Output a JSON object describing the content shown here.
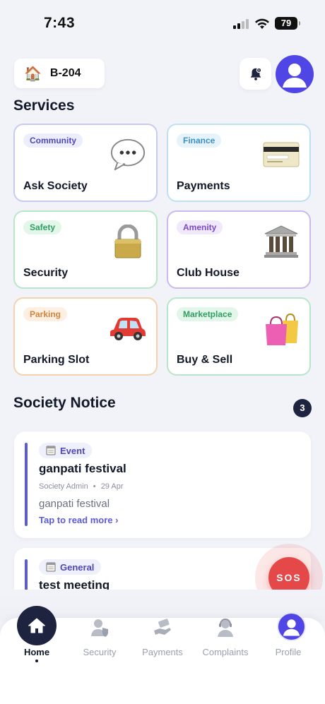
{
  "status_bar": {
    "time": "7:43",
    "battery": "79"
  },
  "header": {
    "unit": "B-204"
  },
  "services": {
    "title": "Services",
    "cards": [
      {
        "tag": "Community",
        "title": "Ask Society",
        "icon": "speech-bubble-icon",
        "tag_color": "#4f46b8",
        "tag_bg": "#eceefd",
        "border": "#c7cbf2"
      },
      {
        "tag": "Finance",
        "title": "Payments",
        "icon": "credit-card-icon",
        "tag_color": "#3b8fc4",
        "tag_bg": "#e7f3fb",
        "border": "#bfe0f3"
      },
      {
        "tag": "Safety",
        "title": "Security",
        "icon": "padlock-icon",
        "tag_color": "#2f9e62",
        "tag_bg": "#e3f6ea",
        "border": "#b7e6c8"
      },
      {
        "tag": "Amenity",
        "title": "Club House",
        "icon": "classical-building-icon",
        "tag_color": "#7a49c8",
        "tag_bg": "#f0e8fb",
        "border": "#cdb8ee"
      },
      {
        "tag": "Parking",
        "title": "Parking Slot",
        "icon": "red-car-icon",
        "tag_color": "#d3843a",
        "tag_bg": "#fdf0e3",
        "border": "#f3d2ad"
      },
      {
        "tag": "Marketplace",
        "title": "Buy & Sell",
        "icon": "shopping-bags-icon",
        "tag_color": "#2f9e62",
        "tag_bg": "#e3f6ea",
        "border": "#b7e6c8"
      }
    ]
  },
  "notices": {
    "title": "Society Notice",
    "count": "3",
    "items": [
      {
        "category": "Event",
        "title": "ganpati festival",
        "author": "Society Admin",
        "separator": "•",
        "date": "29 Apr",
        "body": "ganpati festival",
        "link": "Tap to read more ›"
      },
      {
        "category": "General",
        "title": "test meeting"
      }
    ]
  },
  "sos": {
    "label": "SOS"
  },
  "nav": {
    "items": [
      {
        "label": "Home"
      },
      {
        "label": "Security"
      },
      {
        "label": "Payments"
      },
      {
        "label": "Complaints"
      },
      {
        "label": "Profile"
      }
    ]
  }
}
